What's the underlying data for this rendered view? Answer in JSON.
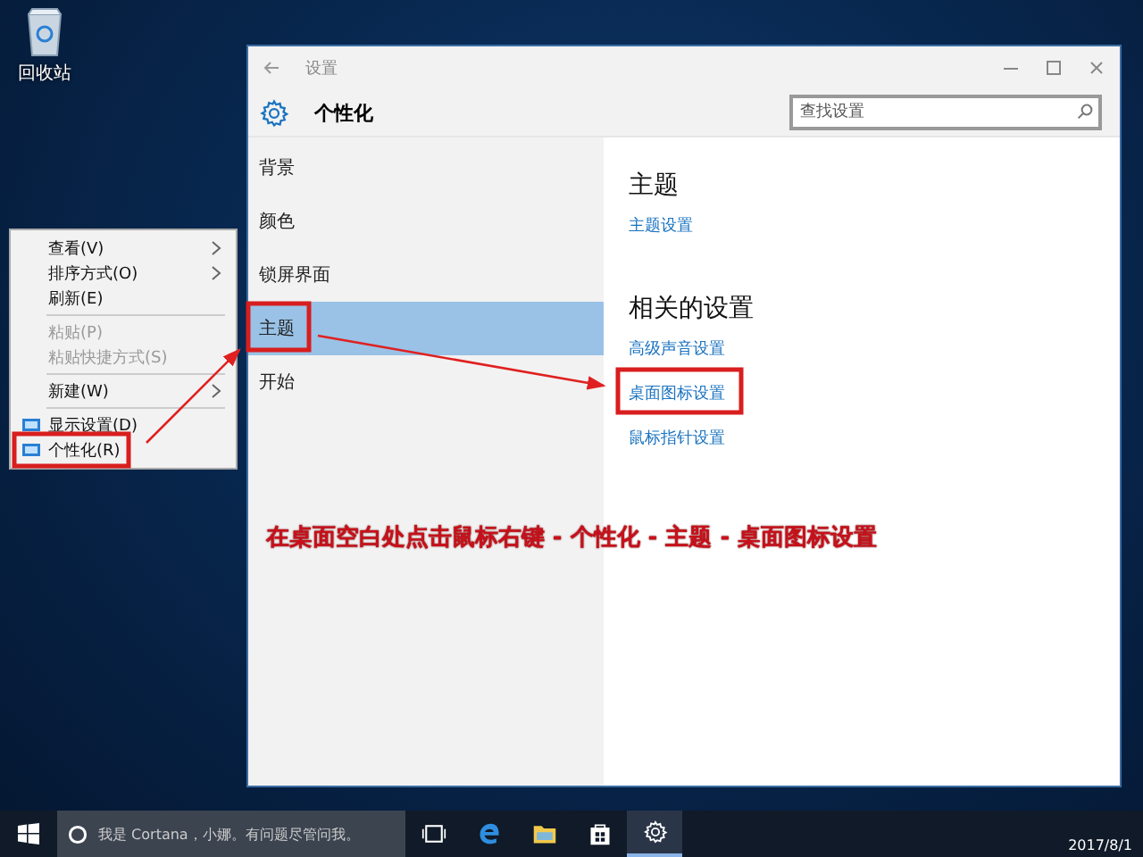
{
  "desktop": {
    "icons": [
      {
        "label": "回收站"
      }
    ]
  },
  "context_menu": {
    "items": [
      {
        "kind": "item",
        "label": "查看(V)",
        "submenu": true,
        "disabled": false
      },
      {
        "kind": "item",
        "label": "排序方式(O)",
        "submenu": true,
        "disabled": false
      },
      {
        "kind": "item",
        "label": "刷新(E)",
        "submenu": false,
        "disabled": false
      },
      {
        "kind": "separator"
      },
      {
        "kind": "item",
        "label": "粘贴(P)",
        "submenu": false,
        "disabled": true
      },
      {
        "kind": "item",
        "label": "粘贴快捷方式(S)",
        "submenu": false,
        "disabled": true
      },
      {
        "kind": "separator"
      },
      {
        "kind": "item",
        "label": "新建(W)",
        "submenu": true,
        "disabled": false
      },
      {
        "kind": "separator"
      },
      {
        "kind": "icon_item",
        "label": "显示设置(D)",
        "submenu": false,
        "disabled": false
      },
      {
        "kind": "icon_item",
        "label": "个性化(R)",
        "submenu": false,
        "disabled": false
      }
    ]
  },
  "settings_window": {
    "title": "设置",
    "header": "个性化",
    "search": {
      "placeholder": "查找设置"
    },
    "nav": [
      {
        "label": "背景",
        "selected": false
      },
      {
        "label": "颜色",
        "selected": false
      },
      {
        "label": "锁屏界面",
        "selected": false
      },
      {
        "label": "主题",
        "selected": true
      },
      {
        "label": "开始",
        "selected": false
      }
    ],
    "sections": [
      {
        "heading": "主题",
        "links": [
          "主题设置"
        ]
      },
      {
        "heading": "相关的设置",
        "links": [
          "高级声音设置",
          "桌面图标设置",
          "鼠标指针设置"
        ]
      }
    ]
  },
  "annotation": {
    "caption": "在桌面空白处点击鼠标右键 - 个性化 - 主题 - 桌面图标设置"
  },
  "taskbar": {
    "search": {
      "placeholder": "我是 Cortana，小娜。有问题尽管问我。"
    },
    "apps": [
      {
        "kind": "taskview",
        "selected": false
      },
      {
        "kind": "edge",
        "selected": false
      },
      {
        "kind": "explorer",
        "selected": false
      },
      {
        "kind": "store",
        "selected": false
      },
      {
        "kind": "settings",
        "selected": true
      }
    ],
    "date": "2017/8/1"
  }
}
